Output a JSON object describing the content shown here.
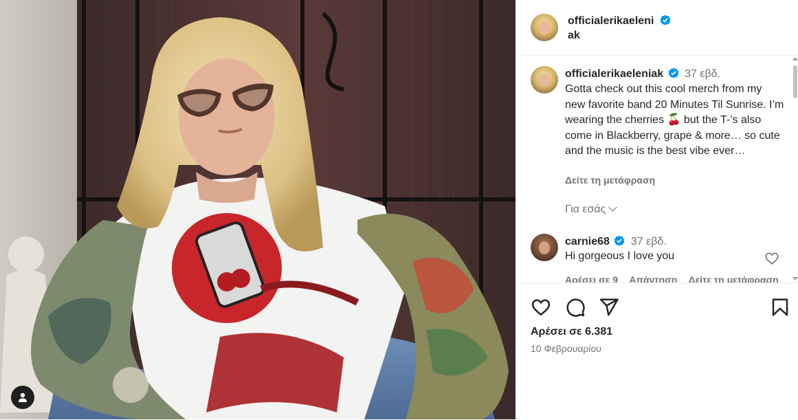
{
  "post": {
    "author": "officialerikaeleniak",
    "author_line1": "officialerikaeleni",
    "author_line2": "ak",
    "verified": true,
    "accent_color": "#0095f6",
    "caption_time": "37 εβδ.",
    "caption": "Gotta check out this cool merch from my new favorite band 20 Minutes Til Sunrise. I’m wearing the cherries 🍒 but the T-’s also come in Blackberry, grape & more… so cute and the music is the best vibe ever…",
    "see_translation": "Δείτε τη μετάφραση",
    "for_you": "Για εσάς",
    "likes": "Αρέσει σε 6.381",
    "date": "10 Φεβρουαρίου"
  },
  "comments": [
    {
      "user": "carnie68",
      "verified": true,
      "time": "37 εβδ.",
      "text": "Hi gorgeous I love you",
      "likes_label": "Αρέσει σε 9",
      "reply_label": "Απάντηση",
      "translate_label": "Δείτε τη μετάφραση"
    }
  ],
  "icons": {
    "like": "heart-icon",
    "comment": "comment-icon",
    "share": "paper-plane-icon",
    "save": "bookmark-icon",
    "tagged_users": "user-icon",
    "verified": "verified-badge-icon",
    "comment_like": "heart-outline-icon",
    "expand": "chevron-down-icon"
  }
}
